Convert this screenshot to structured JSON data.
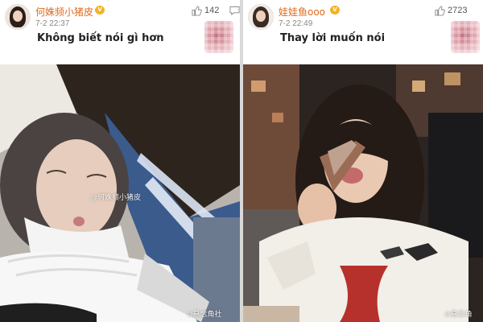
{
  "posts": [
    {
      "username": "何姝频小猪皮",
      "badge": "V",
      "timestamp": "7-2 22:37",
      "likes": "142",
      "text": "Không biết nói gì hơn",
      "photo_watermark": "@何姝频小猪皮",
      "site_watermark": "⊙悬念角社"
    },
    {
      "username": "娃娃鱼ooo",
      "badge": "V",
      "timestamp": "7-2 22:49",
      "likes": "2723",
      "text": "Thay lời muốn nói",
      "site_watermark": "⊙悬念角"
    }
  ],
  "colors": {
    "username": "#e06a1a",
    "badge": "#f3b323",
    "background": "#ffffff",
    "divider": "#d9d9d9"
  },
  "icons": [
    "thumbs-up-icon",
    "comment-icon",
    "vip-badge-icon"
  ]
}
